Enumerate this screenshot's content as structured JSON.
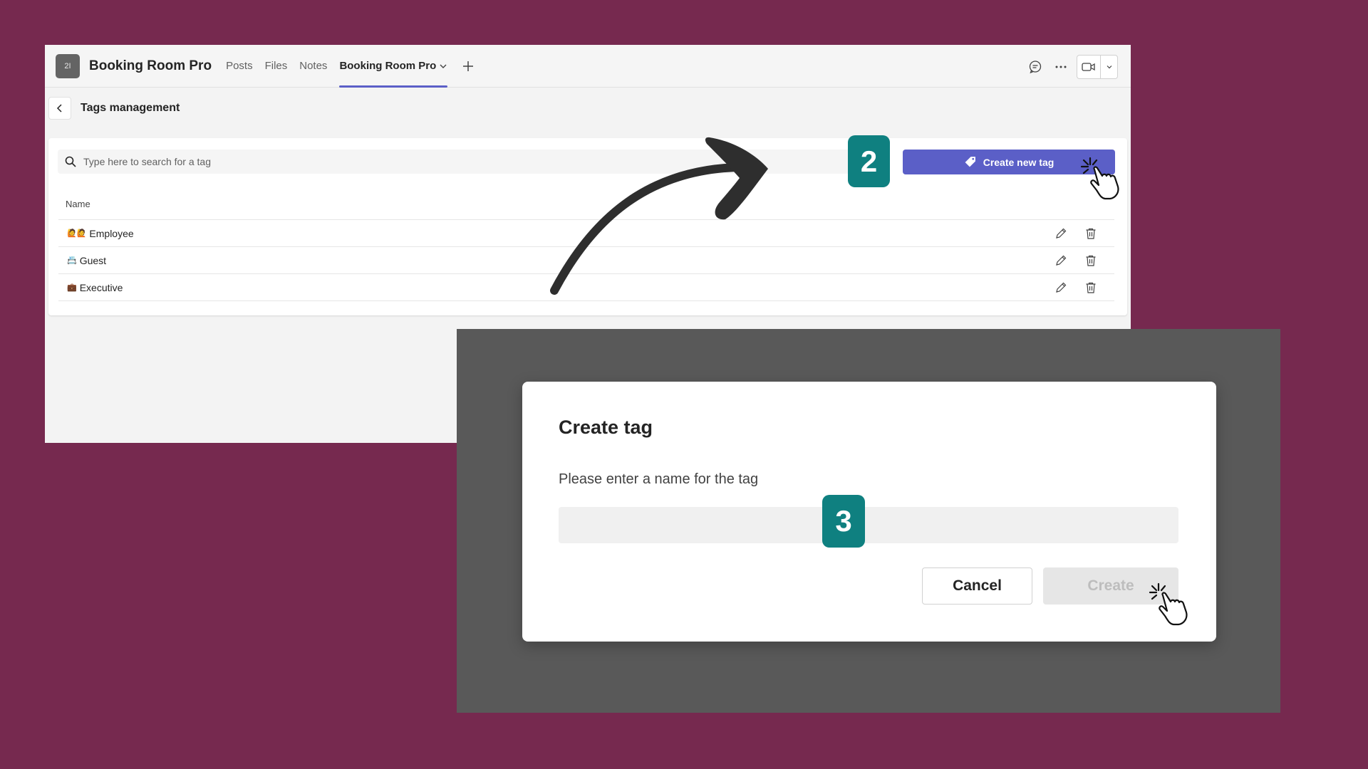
{
  "app": {
    "avatar_text": "2I",
    "title": "Booking Room Pro",
    "tabs": [
      {
        "label": "Posts"
      },
      {
        "label": "Files"
      },
      {
        "label": "Notes"
      },
      {
        "label": "Booking Room Pro",
        "active": true
      }
    ]
  },
  "page": {
    "title": "Tags management"
  },
  "search": {
    "placeholder": "Type here to search for a tag"
  },
  "create_button": {
    "label": "Create new tag"
  },
  "table": {
    "column_name": "Name",
    "rows": [
      {
        "emoji": "🙋🙋",
        "label": "Employee"
      },
      {
        "emoji": "📇",
        "label": "Guest"
      },
      {
        "emoji": "💼",
        "label": "Executive"
      }
    ]
  },
  "dialog": {
    "title": "Create tag",
    "prompt": "Please enter a name for the tag",
    "input_value": "",
    "cancel_label": "Cancel",
    "create_label": "Create"
  },
  "steps": {
    "step_2": "2",
    "step_3": "3"
  },
  "colors": {
    "background": "#76294f",
    "accent": "#5b5fc7",
    "step_badge": "#0f8080",
    "overlay": "#595959"
  }
}
